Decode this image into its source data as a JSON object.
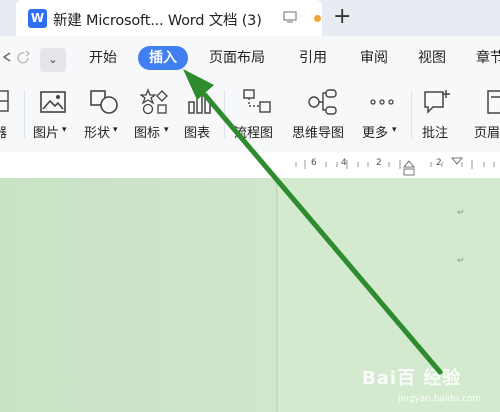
{
  "window": {
    "tab_title": "新建 Microsoft... Word 文档 (3)",
    "app_icon_letter": "W",
    "new_tab_symbol": "+"
  },
  "menu": {
    "more_symbol": "⌄",
    "items": [
      "开始",
      "插入",
      "页面布局",
      "引用",
      "审阅",
      "视图",
      "章节"
    ],
    "active": "插入"
  },
  "ribbon": {
    "partial_left_label": "器",
    "tools": [
      {
        "label": "图片",
        "has_dropdown": true
      },
      {
        "label": "形状",
        "has_dropdown": true
      },
      {
        "label": "图标",
        "has_dropdown": true
      },
      {
        "label": "图表",
        "has_dropdown": false
      },
      {
        "label": "流程图",
        "has_dropdown": false
      },
      {
        "label": "思维导图",
        "has_dropdown": false
      },
      {
        "label": "更多",
        "has_dropdown": true
      },
      {
        "label": "批注",
        "has_dropdown": false
      },
      {
        "label": "页眉",
        "has_dropdown": false
      }
    ],
    "dropdown_symbol": "▾"
  },
  "ruler": {
    "numbers": [
      "6",
      "4",
      "2",
      "2"
    ]
  },
  "document": {
    "paragraph_mark": "↵"
  },
  "watermark": {
    "text": "Bai百 经验",
    "sub": "jingyan.baidu.com"
  },
  "annotation": {
    "arrow_color": "#2e8b2e"
  }
}
